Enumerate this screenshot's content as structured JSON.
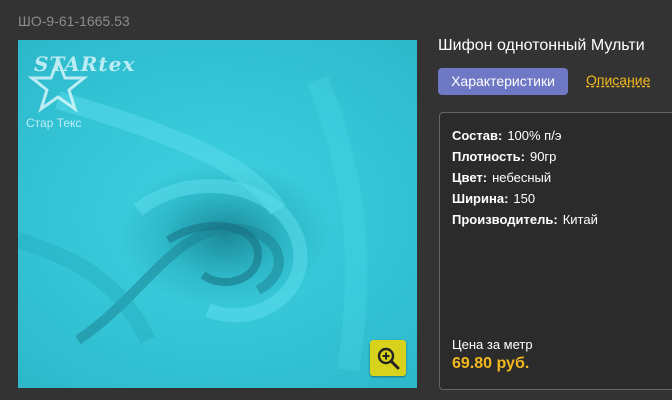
{
  "product": {
    "sku": "ШО-9-61-1665.53",
    "title": "Шифон однотонный Мульти",
    "logo_text": "STARtex",
    "logo_caption": "Стар Текс"
  },
  "tabs": {
    "characteristics": "Характеристики",
    "description": "Описание"
  },
  "specs": [
    {
      "key": "Состав:",
      "value": "100% п/э"
    },
    {
      "key": "Плотность:",
      "value": "90гр"
    },
    {
      "key": "Цвет:",
      "value": "небесный"
    },
    {
      "key": "Ширина:",
      "value": "150"
    },
    {
      "key": "Производитель:",
      "value": "Китай"
    }
  ],
  "price": {
    "label": "Цена за метр",
    "value": "69.80 руб."
  },
  "colors": {
    "background": "#333333",
    "accent_tab": "#6f78c4",
    "price": "#f2b81c",
    "zoom_button": "#d8d21c",
    "fabric": "#33c4d6"
  },
  "icons": {
    "zoom": "zoom-in-icon",
    "logo_star": "star-icon"
  }
}
